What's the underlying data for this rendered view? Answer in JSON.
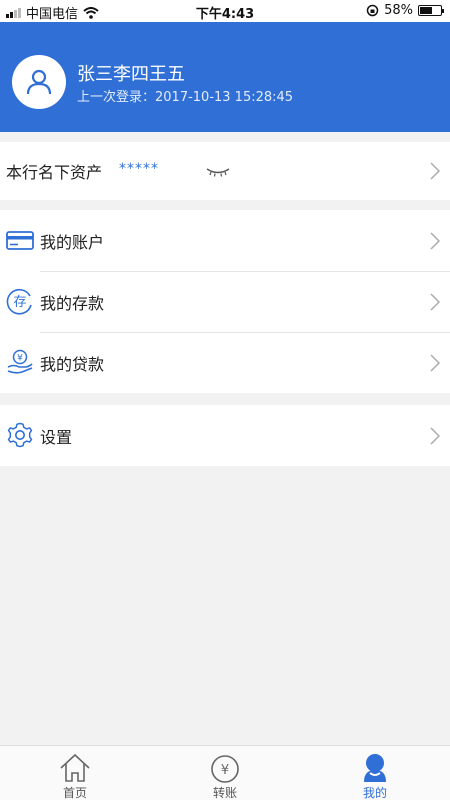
{
  "status_bar": {
    "carrier": "中国电信",
    "time": "下午4:43",
    "battery": "58%",
    "battery_level": 0.58
  },
  "profile": {
    "name": "张三李四王五",
    "last_login": "上一次登录：2017-10-13 15:28:45"
  },
  "assets": {
    "label": "本行名下资产",
    "masked_value": "*****"
  },
  "menu": {
    "items": [
      {
        "label": "我的账户"
      },
      {
        "label": "我的存款",
        "icon_text": "存"
      },
      {
        "label": "我的贷款",
        "icon_text": "¥"
      }
    ]
  },
  "settings": {
    "label": "设置"
  },
  "tabs": [
    {
      "label": "首页"
    },
    {
      "label": "转账",
      "icon_text": "¥"
    },
    {
      "label": "我的"
    }
  ],
  "colors": {
    "accent": "#2f6fd6",
    "background": "#f2f2f2"
  }
}
